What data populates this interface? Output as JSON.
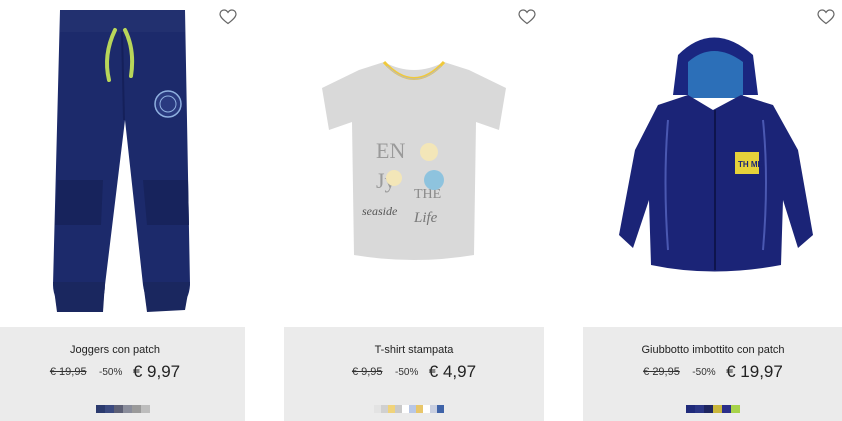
{
  "products": [
    {
      "name": "Joggers con patch",
      "old_price": "€ 19,95",
      "discount": "-50%",
      "price": "€ 9,97",
      "image": "navy-joggers",
      "swatches": [
        "#2b3a6e",
        "#3b4a80",
        "#5c5f75",
        "#8a8d9b",
        "#9a9a9a",
        "#bdbdbd"
      ]
    },
    {
      "name": "T-shirt stampata",
      "old_price": "€ 9,95",
      "discount": "-50%",
      "price": "€ 4,97",
      "image": "grey-printed-tshirt",
      "swatches": [
        "#e3e3e3",
        "#d0d0d0",
        "#f0d37a",
        "#c9c9c9",
        "#ffffff",
        "#b8c7e6",
        "#e8c66a",
        "#ffffff",
        "#c9cfe0",
        "#3f63a8"
      ]
    },
    {
      "name": "Giubbotto imbottito con patch",
      "old_price": "€ 29,95",
      "discount": "-50%",
      "price": "€ 19,97",
      "image": "navy-padded-jacket",
      "swatches": [
        "#1f2a7a",
        "#2a3585",
        "#1e2560",
        "#c9b63c",
        "#2b2f8a",
        "#a7d24a"
      ]
    }
  ],
  "icons": {
    "wishlist": "heart-outline-icon"
  }
}
